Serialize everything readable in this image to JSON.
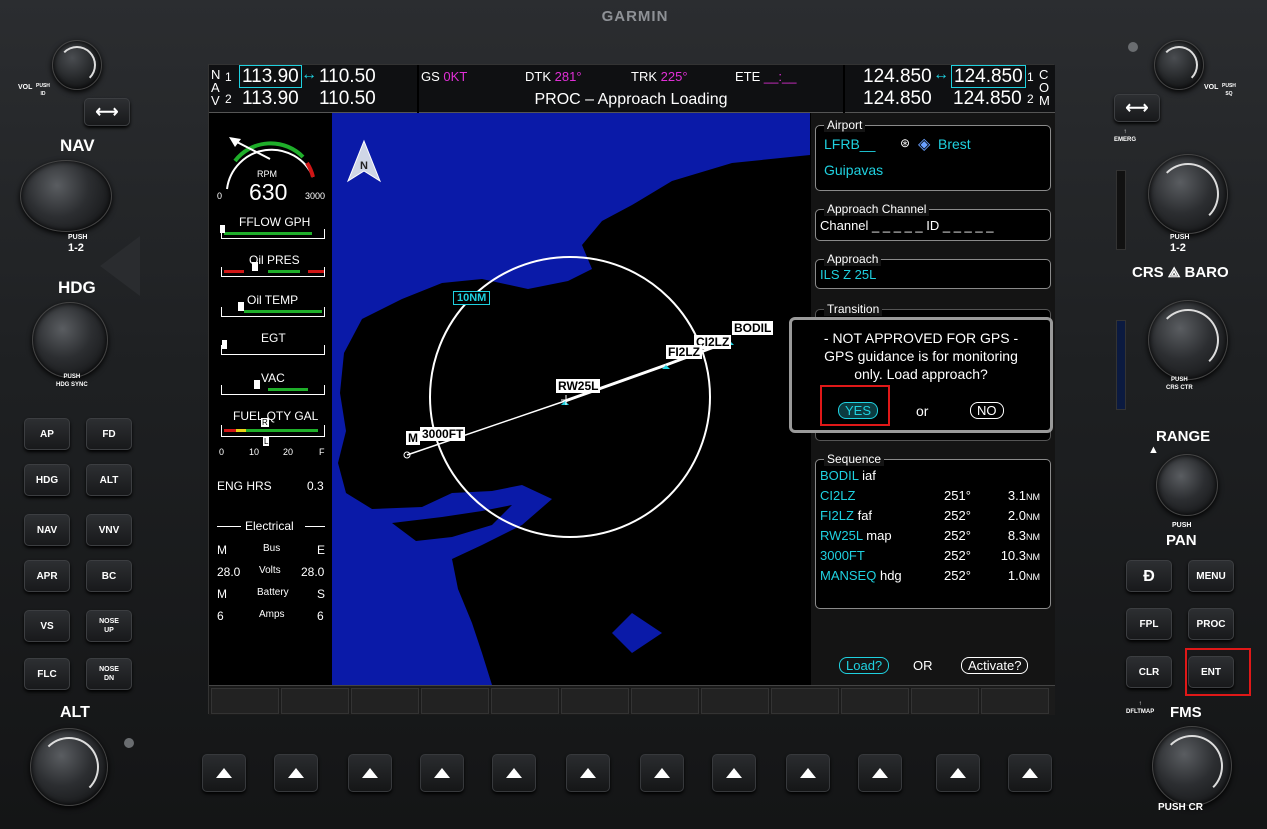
{
  "brand": "GARMIN",
  "left_bezel": {
    "vol_label": "VOL",
    "push_id": "PUSH\nID",
    "nav_label": "NAV",
    "push_12": "PUSH",
    "push_12b": "1-2",
    "hdg_label": "HDG",
    "hdg_push": "PUSH\nHDG SYNC",
    "alt_label": "ALT",
    "buttons": [
      "AP",
      "FD",
      "HDG",
      "ALT",
      "NAV",
      "VNV",
      "APR",
      "BC",
      "VS",
      "NOSE UP",
      "FLC",
      "NOSE DN"
    ]
  },
  "right_bezel": {
    "vol_label": "VOL",
    "push_sq": "PUSH\nSQ",
    "emerg": "EMERG",
    "push_12": "PUSH",
    "push_12b": "1-2",
    "crs": "CRS",
    "baro": "BARO",
    "push_crs": "PUSH\nCRS CTR",
    "range": "RANGE",
    "push_pan": "PUSH",
    "pan": "PAN",
    "direct_icon": "direct-to-icon",
    "menu": "MENU",
    "fpl": "FPL",
    "proc": "PROC",
    "clr": "CLR",
    "ent": "ENT",
    "dfltmap": "DFLTMAP",
    "fms": "FMS",
    "push_crsr": "PUSH CR"
  },
  "header": {
    "nav_side": "N\nA\nV",
    "nav1_num": "1",
    "nav2_num": "2",
    "nav1_active": "113.90",
    "nav1_standby": "110.50",
    "nav2_active": "113.90",
    "nav2_standby": "110.50",
    "swap": "↔",
    "gs_label": "GS",
    "gs_value": "0KT",
    "dtk_label": "DTK",
    "dtk_value": "281°",
    "trk_label": "TRK",
    "trk_value": "225°",
    "ete_label": "ETE",
    "ete_value": "__:__",
    "message": "PROC – Approach Loading",
    "com1_active": "124.850",
    "com1_standby": "124.850",
    "com2_active": "124.850",
    "com2_standby": "124.850",
    "com_side": "C\nO\nM",
    "com1_num": "1",
    "com2_num": "2"
  },
  "engine": {
    "rpm_label": "RPM",
    "rpm_value": "630",
    "rpm_min": "0",
    "rpm_max": "3000",
    "fflow": "FFLOW GPH",
    "oil_pres": "Oil PRES",
    "oil_temp": "Oil TEMP",
    "egt": "EGT",
    "vac": "VAC",
    "fuel_qty": "FUEL QTY GAL",
    "fuel_ticks": [
      "0",
      "10",
      "20",
      "F"
    ],
    "fuel_r": "R",
    "fuel_l": "L",
    "eng_hrs_label": "ENG HRS",
    "eng_hrs_value": "0.3",
    "electrical": "Electrical",
    "bus_label": "Bus",
    "bus_m": "M",
    "bus_e": "E",
    "volts_label": "Volts",
    "volts_l": "28.0",
    "volts_r": "28.0",
    "battery_label": "Battery",
    "bat_m": "M",
    "bat_s": "S",
    "amps_label": "Amps",
    "amps_l": "6",
    "amps_r": "6"
  },
  "map": {
    "north": "N",
    "range_label": "10NM",
    "waypoints": [
      "BODIL",
      "CI2LZ",
      "FI2LZ",
      "RW25L",
      "3000FT",
      "M"
    ]
  },
  "procedure": {
    "airport_title": "Airport",
    "airport_id": "LFRB__",
    "airport_city": "Brest",
    "airport_name": "Guipavas",
    "channel_title": "Approach Channel",
    "channel_text": "Channel _ _ _ _ _ ID _ _ _ _ _",
    "approach_title": "Approach",
    "approach_value": "ILS Z 25L",
    "transition_title": "Transition",
    "sequence_title": "Sequence",
    "sequence": [
      {
        "wpt": "BODIL",
        "tag": "iaf",
        "crs": "",
        "dist": "",
        "unit": ""
      },
      {
        "wpt": "CI2LZ",
        "tag": "",
        "crs": "251°",
        "dist": "3.1",
        "unit": "NM"
      },
      {
        "wpt": "FI2LZ",
        "tag": "faf",
        "crs": "252°",
        "dist": "2.0",
        "unit": "NM"
      },
      {
        "wpt": "RW25L",
        "tag": "map",
        "crs": "252°",
        "dist": "8.3",
        "unit": "NM"
      },
      {
        "wpt": "3000FT",
        "tag": "",
        "crs": "252°",
        "dist": "10.3",
        "unit": "NM"
      },
      {
        "wpt": "MANSEQ",
        "tag": "hdg",
        "crs": "252°",
        "dist": "1.0",
        "unit": "NM"
      }
    ],
    "load_label": "Load?",
    "or_label": "OR",
    "activate_label": "Activate?"
  },
  "dialog": {
    "line1": "- NOT APPROVED FOR GPS -",
    "line2": "GPS guidance is for monitoring",
    "line3": "only. Load approach?",
    "yes": "YES",
    "or": "or",
    "no": "NO"
  },
  "colors": {
    "cyan": "#1fd1e0",
    "magenta": "#e02fd6",
    "map_water": "#0a1aa8",
    "highlight": "#e01818"
  }
}
